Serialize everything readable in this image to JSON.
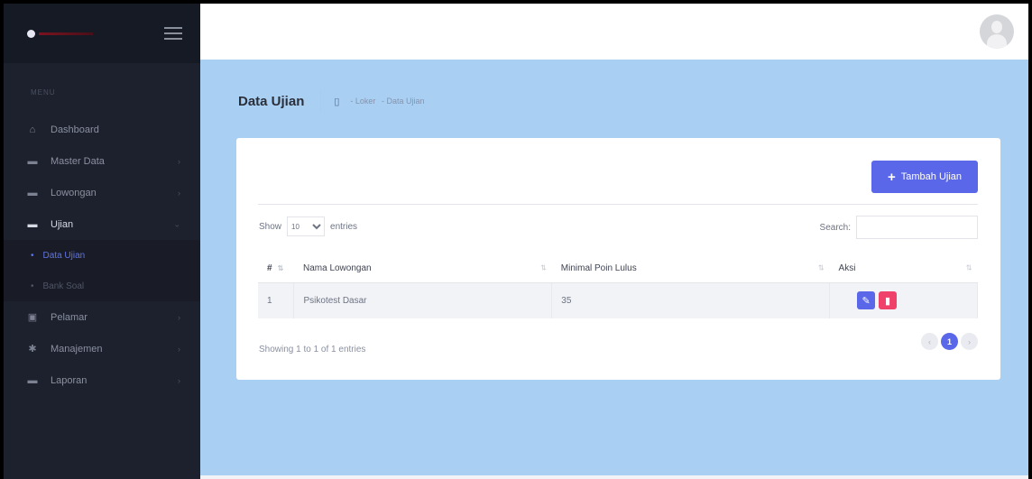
{
  "sidebar": {
    "menu_label": "MENU",
    "items": [
      {
        "label": "Dashboard",
        "icon": "home-icon",
        "glyph": "⌂"
      },
      {
        "label": "Master Data",
        "icon": "folder-icon",
        "glyph": "▬",
        "chevron": "›"
      },
      {
        "label": "Lowongan",
        "icon": "briefcase-icon",
        "glyph": "▬",
        "chevron": "›"
      },
      {
        "label": "Ujian",
        "icon": "archive-icon",
        "glyph": "▬",
        "chevron": "⌄"
      },
      {
        "label": "Pelamar",
        "icon": "user-card-icon",
        "glyph": "▣",
        "chevron": "›"
      },
      {
        "label": "Manajemen",
        "icon": "gear-icon",
        "glyph": "✱",
        "chevron": "›"
      },
      {
        "label": "Laporan",
        "icon": "folder-icon",
        "glyph": "▬",
        "chevron": "›"
      }
    ],
    "submenu": [
      {
        "label": "Data Ujian",
        "bullet": "•"
      },
      {
        "label": "Bank Soal",
        "bullet": "•"
      }
    ]
  },
  "header": {
    "title": "Data Ujian",
    "breadcrumb": [
      "- Loker",
      "- Data Ujian"
    ]
  },
  "card": {
    "add_button": "Tambah Ujian",
    "add_glyph": "+",
    "show_label": "Show",
    "entries_value": "10",
    "entries_label": "entries",
    "search_label": "Search:",
    "columns": [
      "#",
      "Nama Lowongan",
      "Minimal Poin Lulus",
      "Aksi"
    ],
    "rows": [
      {
        "no": "1",
        "nama": "Psikotest Dasar",
        "poin": "35"
      }
    ],
    "info": "Showing 1 to 1 of 1 entries",
    "pagination": {
      "prev": "‹",
      "current": "1",
      "next": "›"
    }
  },
  "colors": {
    "accent": "#5a67e8",
    "danger": "#f0416b",
    "content_bg": "#a9cff2",
    "sidebar_bg": "#1d212e"
  }
}
